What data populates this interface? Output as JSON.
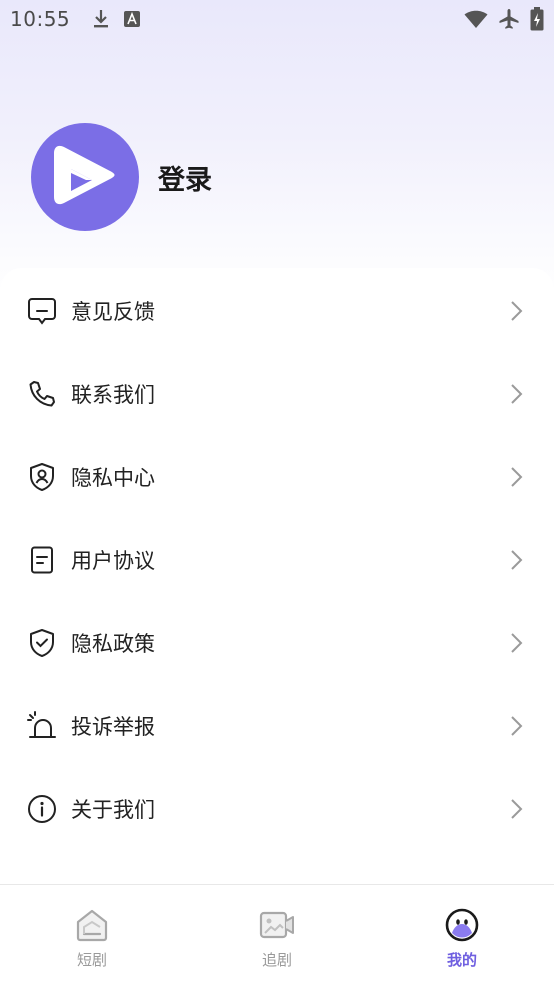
{
  "status_bar": {
    "time": "10:55",
    "left_icons": [
      "download-icon",
      "font-icon"
    ],
    "right_icons": [
      "wifi-icon",
      "airplane-icon",
      "battery-charging-icon"
    ]
  },
  "profile": {
    "login_label": "登录",
    "avatar_icon": "play-logo-icon",
    "avatar_color": "#7b6ee6"
  },
  "menu": {
    "items": [
      {
        "label": "意见反馈",
        "icon": "feedback-icon"
      },
      {
        "label": "联系我们",
        "icon": "phone-icon"
      },
      {
        "label": "隐私中心",
        "icon": "privacy-shield-user-icon"
      },
      {
        "label": "用户协议",
        "icon": "document-icon"
      },
      {
        "label": "隐私政策",
        "icon": "shield-check-icon"
      },
      {
        "label": "投诉举报",
        "icon": "alarm-icon"
      },
      {
        "label": "关于我们",
        "icon": "info-icon"
      }
    ]
  },
  "tabbar": {
    "tabs": [
      {
        "label": "短剧",
        "icon": "home-icon",
        "active": false
      },
      {
        "label": "追剧",
        "icon": "video-camera-icon",
        "active": false
      },
      {
        "label": "我的",
        "icon": "mine-face-icon",
        "active": true
      }
    ],
    "active_color": "#6f5fe0",
    "inactive_color": "#9a9a9a"
  }
}
